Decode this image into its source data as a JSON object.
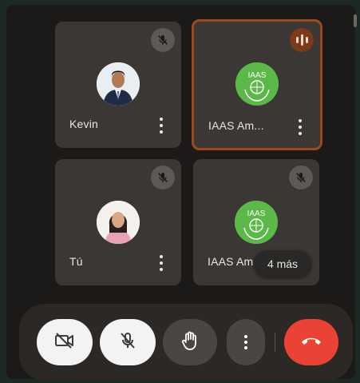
{
  "participants": [
    {
      "name": "Kevin",
      "mic_muted": true,
      "speaking": false
    },
    {
      "name": "IAAS Am...",
      "mic_muted": false,
      "speaking": true
    },
    {
      "name": "Tú",
      "mic_muted": true,
      "speaking": false
    },
    {
      "name": "IAAS Am",
      "mic_muted": true,
      "speaking": false
    }
  ],
  "more_participants": "4 más",
  "logo_text": "IAAS",
  "toolbar": {
    "camera_icon": "camera-off-icon",
    "mic_icon": "mic-off-icon",
    "hand_icon": "raise-hand-icon",
    "more_icon": "more-options-icon",
    "end_call_icon": "end-call-icon"
  },
  "colors": {
    "tile_bg": "#3b3734",
    "active_border": "#9a4a1e",
    "end_call": "#ea4335",
    "logo_green": "#5cb848"
  }
}
